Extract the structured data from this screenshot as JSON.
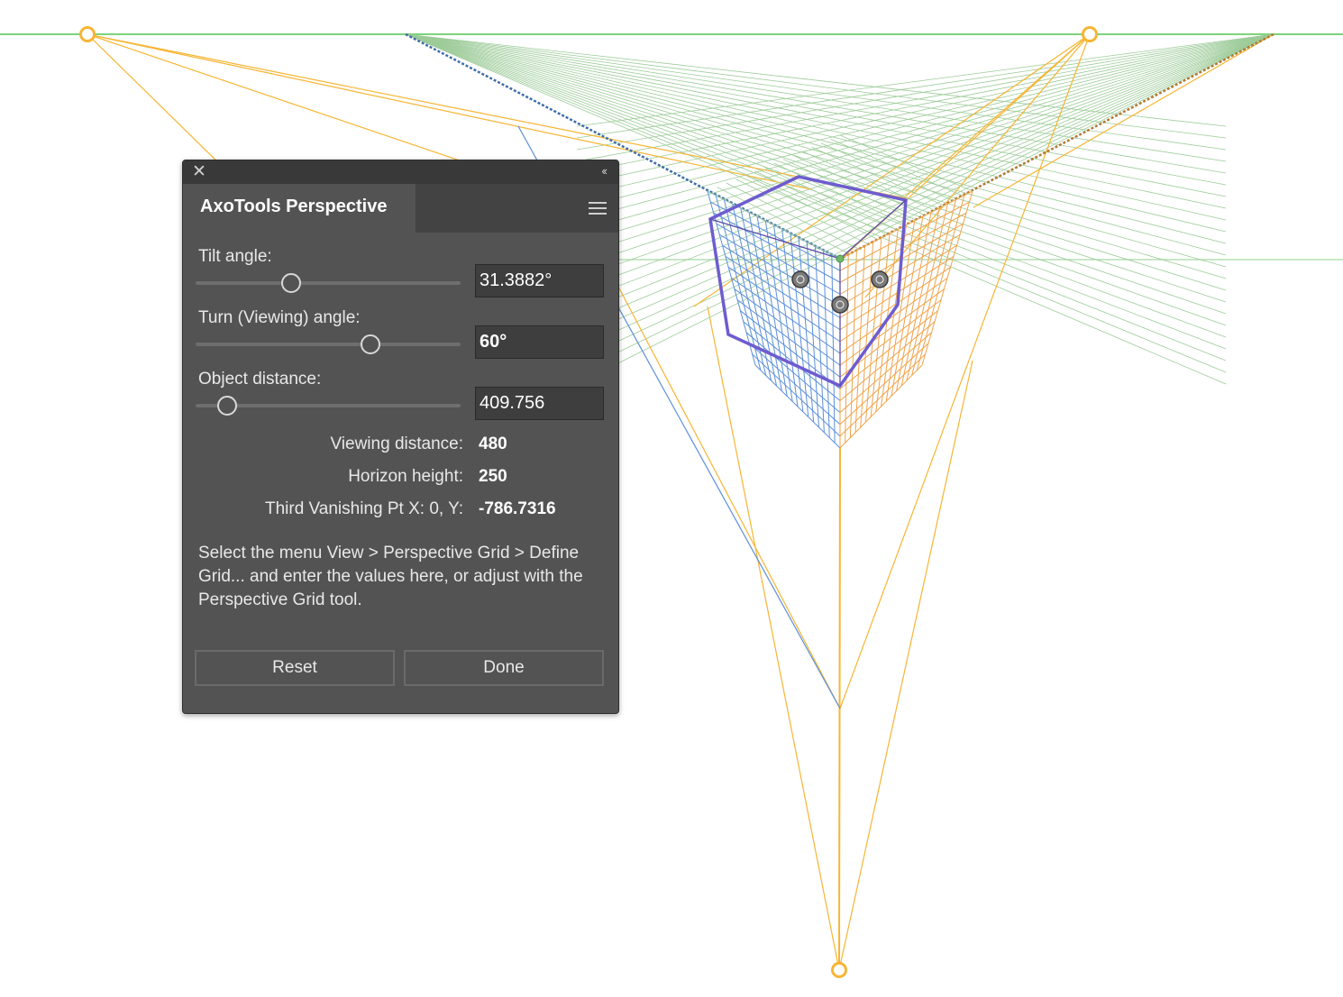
{
  "panel": {
    "title": "AxoTools Perspective",
    "close_icon": "close-icon",
    "collapse_icon": "double-chevron-left-icon",
    "menu_icon": "hamburger-menu-icon"
  },
  "tilt": {
    "label": "Tilt angle:",
    "value": "31.3882°",
    "slider_fraction": 0.36
  },
  "turn": {
    "label": "Turn (Viewing) angle:",
    "value": "60°",
    "slider_fraction": 0.66
  },
  "distance": {
    "label": "Object distance:",
    "value": "409.756",
    "slider_fraction": 0.12
  },
  "info": {
    "viewing_label": "Viewing distance:",
    "viewing_value": "480",
    "horizon_label": "Horizon height:",
    "horizon_value": "250",
    "third_label": "Third Vanishing Pt X: 0, Y:",
    "third_value": "-786.7316"
  },
  "help_text": "Select the menu View > Perspective Grid > Define Grid... and enter the values here, or adjust with the Perspective Grid tool.",
  "buttons": {
    "reset": "Reset",
    "done": "Done"
  },
  "colors": {
    "horizon": "#7ed37a",
    "vanishing": "#f7b533",
    "left_grid": "#5b8fd8",
    "right_grid": "#f0a34a",
    "cube_outline": "#6e5ccf",
    "panel_bg": "#535353"
  }
}
